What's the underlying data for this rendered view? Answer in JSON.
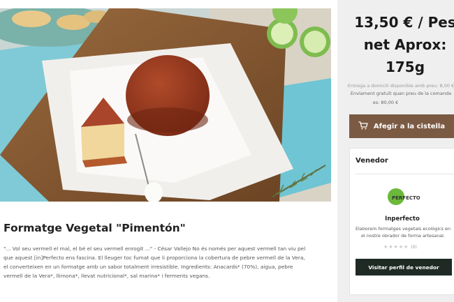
{
  "product": {
    "title": "Formatge Vegetal \"Pimentón\"",
    "description": "\"... Vol seu vermell el mal, el bé el seu vermell enrogit ...\" - César Vallejo No és només per aquest vermell tan viu pel que aquest [in]Perfecto ens fascina. El lleuger toc fumat que li proporciona la cobertura de pebre vermell de la Vera, el converteixen en un formatge amb un sabor totalment irresistible. Ingredients: Anacards* (70%), aigua, pebre vermell de la Vera*, llimona*, llevat nutricional*, sal marina* i ferments vegans.",
    "image_icon": "cheese-photo"
  },
  "purchase": {
    "price_line1": "13,50 € / Pes",
    "price_line2": "net Aprox:",
    "price_line3": "175g",
    "delivery_note": "Entrega a domicili disponible amb preu: 8,00 €",
    "free_shipping_note": "Enviament gratuït quan preu de la comanda",
    "free_shipping_threshold": "es: 80,00 €",
    "add_to_cart_label": "Afegir a la cistella",
    "cart_icon": "cart-icon"
  },
  "vendor": {
    "heading": "Venedor",
    "logo_text": "PERFECTO",
    "name": "Inperfecto",
    "description": "Elaborem formatges vegetals ecològics en el nostre obrador de forma artesanal.",
    "rating_stars": "★★★★★",
    "rating_count": "(0)",
    "rating_value": 0,
    "visit_label": "Visitar perfil de venedor"
  },
  "colors": {
    "cart_button": "#7b5a43",
    "visit_button": "#1f2a25",
    "logo_green": "#6bb83a"
  }
}
